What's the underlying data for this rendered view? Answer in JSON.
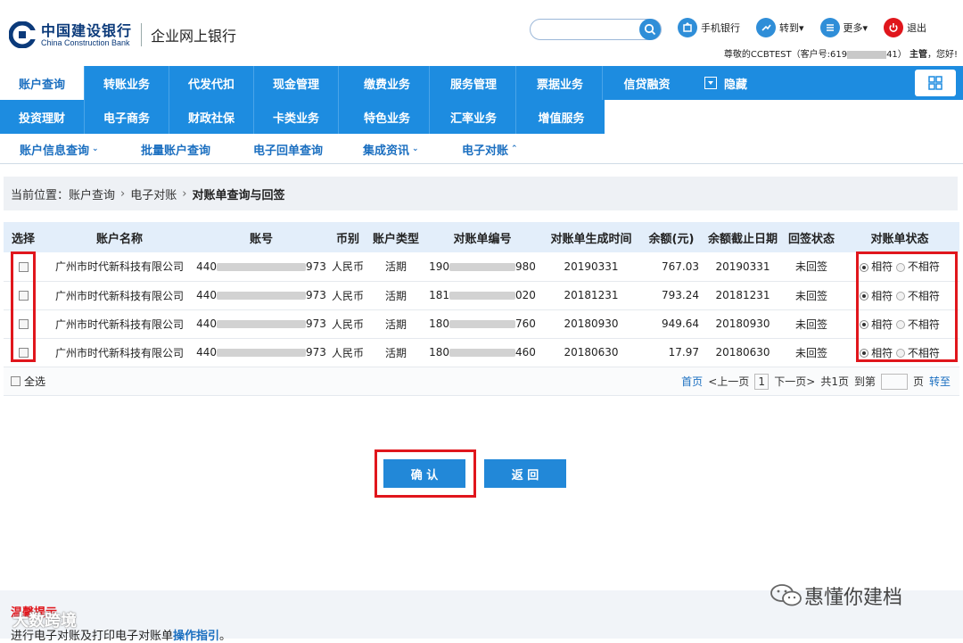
{
  "header": {
    "bank_name_cn": "中国建设银行",
    "bank_name_en": "China Construction Bank",
    "system_name": "企业网上银行",
    "search_placeholder": "",
    "links": [
      {
        "label": "手机银行",
        "icon": "mobile-bank-icon",
        "color": "#2f8ed8"
      },
      {
        "label": "转到▾",
        "icon": "goto-icon",
        "color": "#2f8ed8"
      },
      {
        "label": "更多▾",
        "icon": "more-icon",
        "color": "#2f8ed8"
      },
      {
        "label": "退出",
        "icon": "power-icon",
        "color": "#e0161c"
      }
    ],
    "welcome_prefix": "尊敬的CCBTEST（客户号:619",
    "welcome_suffix": "41）",
    "role": "主管",
    "greeting": "，您好!"
  },
  "nav": {
    "row1": [
      "账户查询",
      "转账业务",
      "代发代扣",
      "现金管理",
      "缴费业务",
      "服务管理",
      "票据业务",
      "信贷融资"
    ],
    "row2": [
      "投资理财",
      "电子商务",
      "财政社保",
      "卡类业务",
      "特色业务",
      "汇率业务",
      "增值服务"
    ],
    "hide_label": "隐藏",
    "active": "账户查询"
  },
  "subnav": [
    {
      "label": "账户信息查询",
      "chevron": "⌄"
    },
    {
      "label": "批量账户查询",
      "chevron": ""
    },
    {
      "label": "电子回单查询",
      "chevron": ""
    },
    {
      "label": "集成资讯",
      "chevron": "⌄"
    },
    {
      "label": "电子对账",
      "chevron": "⌃"
    }
  ],
  "breadcrumb": {
    "prefix": "当前位置：",
    "items": [
      "账户查询",
      "电子对账"
    ],
    "current": "对账单查询与回签"
  },
  "table": {
    "headers": [
      "选择",
      "账户名称",
      "账号",
      "币别",
      "账户类型",
      "对账单编号",
      "对账单生成时间",
      "余额(元)",
      "余额截止日期",
      "回签状态",
      "对账单状态"
    ],
    "rows": [
      {
        "name": "广州市时代新科技有限公司",
        "acct_pre": "440",
        "acct_suf": "973",
        "currency": "人民币",
        "type": "活期",
        "no_pre": "190",
        "no_suf": "980",
        "gen_time": "20190331",
        "balance": "767.03",
        "cutoff": "20190331",
        "sign_status": "未回签"
      },
      {
        "name": "广州市时代新科技有限公司",
        "acct_pre": "440",
        "acct_suf": "973",
        "currency": "人民币",
        "type": "活期",
        "no_pre": "181",
        "no_suf": "020",
        "gen_time": "20181231",
        "balance": "793.24",
        "cutoff": "20181231",
        "sign_status": "未回签"
      },
      {
        "name": "广州市时代新科技有限公司",
        "acct_pre": "440",
        "acct_suf": "973",
        "currency": "人民币",
        "type": "活期",
        "no_pre": "180",
        "no_suf": "760",
        "gen_time": "20180930",
        "balance": "949.64",
        "cutoff": "20180930",
        "sign_status": "未回签"
      },
      {
        "name": "广州市时代新科技有限公司",
        "acct_pre": "440",
        "acct_suf": "973",
        "currency": "人民币",
        "type": "活期",
        "no_pre": "180",
        "no_suf": "460",
        "gen_time": "20180630",
        "balance": "17.97",
        "cutoff": "20180630",
        "sign_status": "未回签"
      }
    ],
    "status_match": "相符",
    "status_nomatch": "不相符",
    "select_all": "全选"
  },
  "pager": {
    "first": "首页",
    "prev": "<上一页",
    "current": "1",
    "next": "下一页>",
    "total": "共1页",
    "goto_prefix": "到第",
    "goto_suffix": "页",
    "go": "转至"
  },
  "buttons": {
    "confirm": "确 认",
    "back": "返 回"
  },
  "tips": {
    "title": "温馨提示",
    "text": "进行电子对账及打印电子对账单",
    "link": "操作指引",
    "tail": "。"
  },
  "watermarks": {
    "left": "大数跨境",
    "right": "惠懂你建档"
  },
  "colors": {
    "nav_blue": "#1d8ce0",
    "brand_dark": "#0b3a7a",
    "highlight_red": "#e0161c",
    "link_blue": "#1b6fc0"
  }
}
